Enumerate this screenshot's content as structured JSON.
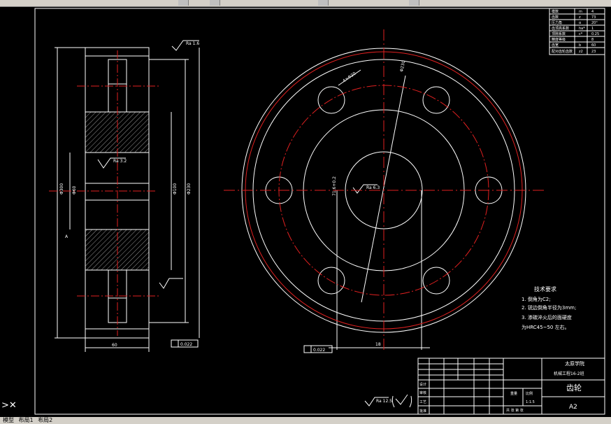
{
  "title_block": {
    "school": "太原学院",
    "class_line": "机械工程16-2班",
    "part_name": "齿轮",
    "scale": "1:1.5",
    "sheet_size": "A2",
    "rows": [
      "设计",
      "审核",
      "工艺",
      "批准"
    ],
    "weight_label": "重量",
    "scale_label": "比例",
    "count_label": "共 张  第 张"
  },
  "tech_requirements": {
    "heading": "技术要求",
    "items": [
      "1. 倒角为C2;",
      "2. 锐边倒角半径为3mm;",
      "3. 渗碳淬火后的面硬度",
      "为HRC45~50 左右。"
    ]
  },
  "roughness_note": "Ra 12.5",
  "param_table": {
    "rows": [
      [
        "模数",
        "m",
        "4"
      ],
      [
        "齿数",
        "z",
        "73"
      ],
      [
        "压力角",
        "α",
        "20°"
      ],
      [
        "齿顶高系数",
        "ha*",
        "1"
      ],
      [
        "顶隙系数",
        "c*",
        "0.25"
      ],
      [
        "精度等级",
        "",
        "8"
      ],
      [
        "齿宽",
        "b",
        "60"
      ],
      [
        "配对齿轮齿数",
        "z2",
        "23"
      ]
    ]
  },
  "dimensions": {
    "hole_dia": "4×Φ30",
    "bolt_circle": "Φ230",
    "key_depth": "71.6+0.2",
    "keyway_width": "18",
    "width": "60",
    "gear_bore": "Φ60",
    "outer_dia": "Φ300",
    "hub": "Φ100",
    "roughness_a": "Ra 1.6",
    "roughness_b": "Ra 3.2",
    "roughness_c": "Ra 6.3",
    "tolerance": "0.022",
    "datum": "A"
  },
  "tabs": [
    "模型",
    "布局1",
    "布局2"
  ]
}
